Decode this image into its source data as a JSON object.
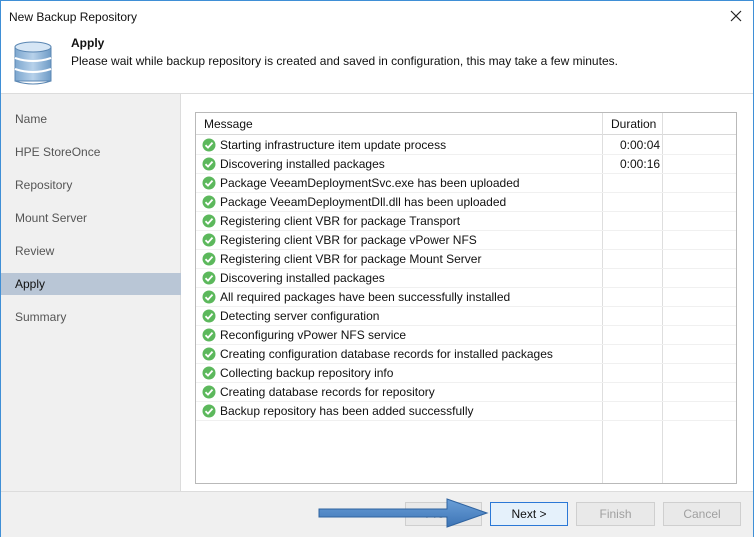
{
  "window": {
    "title": "New Backup Repository"
  },
  "header": {
    "step_title": "Apply",
    "step_description": "Please wait while backup repository is created and saved in configuration, this may take a few minutes."
  },
  "sidebar": {
    "items": [
      {
        "label": "Name"
      },
      {
        "label": "HPE StoreOnce"
      },
      {
        "label": "Repository"
      },
      {
        "label": "Mount Server"
      },
      {
        "label": "Review"
      },
      {
        "label": "Apply"
      },
      {
        "label": "Summary"
      }
    ],
    "active": "Apply"
  },
  "log_table": {
    "headers": {
      "message": "Message",
      "duration": "Duration"
    },
    "rows": [
      {
        "message": "Starting infrastructure item update process",
        "duration": "0:00:04"
      },
      {
        "message": "Discovering installed packages",
        "duration": "0:00:16"
      },
      {
        "message": "Package VeeamDeploymentSvc.exe has been uploaded",
        "duration": ""
      },
      {
        "message": "Package VeeamDeploymentDll.dll has been uploaded",
        "duration": ""
      },
      {
        "message": "Registering client VBR for package Transport",
        "duration": ""
      },
      {
        "message": "Registering client VBR for package vPower NFS",
        "duration": ""
      },
      {
        "message": "Registering client VBR for package Mount Server",
        "duration": ""
      },
      {
        "message": "Discovering installed packages",
        "duration": ""
      },
      {
        "message": "All required packages have been successfully installed",
        "duration": ""
      },
      {
        "message": "Detecting server configuration",
        "duration": ""
      },
      {
        "message": "Reconfiguring vPower NFS service",
        "duration": ""
      },
      {
        "message": "Creating configuration database records for installed packages",
        "duration": ""
      },
      {
        "message": "Collecting backup repository info",
        "duration": ""
      },
      {
        "message": "Creating database records for repository",
        "duration": ""
      },
      {
        "message": "Backup repository has been added successfully",
        "duration": ""
      }
    ],
    "status_icon": "success-check-icon",
    "status_color": "#5cb85c"
  },
  "footer": {
    "previous_label": "< Previous",
    "next_label": "Next >",
    "finish_label": "Finish",
    "cancel_label": "Cancel"
  },
  "colors": {
    "accent": "#2b78d6",
    "arrow": "#4a86c8",
    "active_nav": "#b9c6d6"
  }
}
